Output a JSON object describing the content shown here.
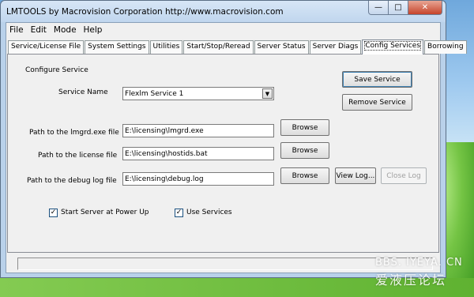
{
  "window": {
    "title": "LMTOOLS by Macrovision Corporation http://www.macrovision.com"
  },
  "caption_buttons": {
    "minimize": "—",
    "maximize": "□",
    "close": "✕"
  },
  "menu": [
    "File",
    "Edit",
    "Mode",
    "Help"
  ],
  "tabs": [
    "Service/License File",
    "System Settings",
    "Utilities",
    "Start/Stop/Reread",
    "Server Status",
    "Server Diags",
    "Config Services",
    "Borrowing"
  ],
  "active_tab": "Config Services",
  "config": {
    "section_title": "Configure Service",
    "service_name_label": "Service Name",
    "service_name_value": "Flexlm Service 1",
    "lmgrd_label": "Path to the lmgrd.exe file",
    "lmgrd_value": "E:\\licensing\\lmgrd.exe",
    "license_label": "Path to the license file",
    "license_value": "E:\\licensing\\hostids.bat",
    "debug_label": "Path to the debug log file",
    "debug_value": "E:\\licensing\\debug.log"
  },
  "buttons": {
    "save_service": "Save Service",
    "remove_service": "Remove Service",
    "browse": "Browse",
    "view_log": "View Log...",
    "close_log": "Close Log"
  },
  "checkboxes": {
    "start_at_power_up": {
      "label": "Start Server at Power Up",
      "checked": true
    },
    "use_services": {
      "label": "Use Services",
      "checked": true
    }
  },
  "status_text": "",
  "watermark": {
    "line1": "BBS. IYEYA. CN",
    "line2": "爱液压论坛"
  }
}
